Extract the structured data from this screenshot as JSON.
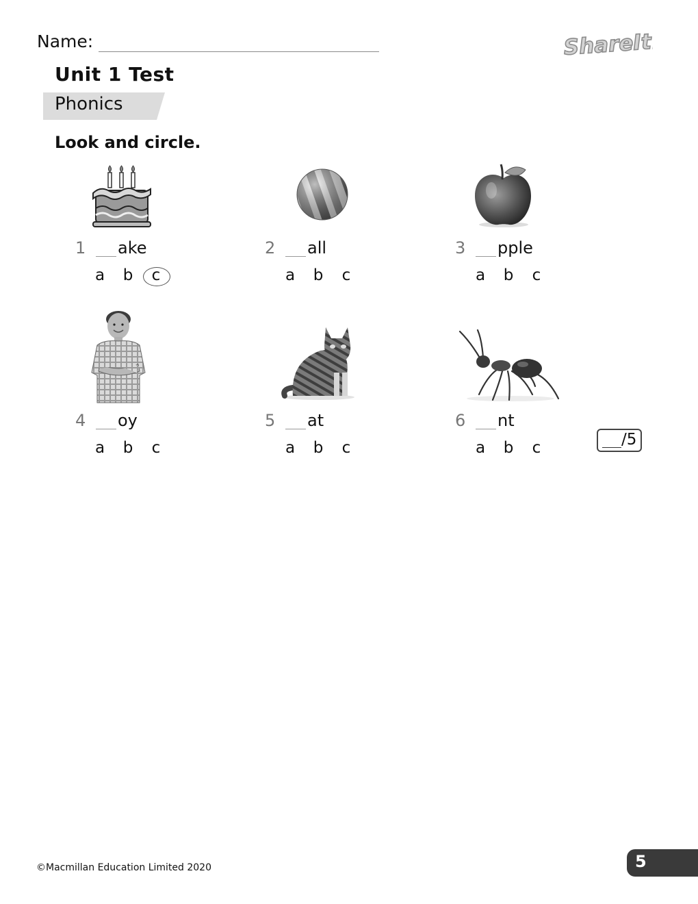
{
  "header": {
    "name_label": "Name:",
    "logo_text": "ShareIt!",
    "unit_title": "Unit 1 Test",
    "section": "Phonics",
    "instruction": "Look and circle."
  },
  "items": [
    {
      "number": "1",
      "word": "ake",
      "picture": "cake-icon",
      "options": [
        "a",
        "b",
        "c"
      ],
      "circled": "c"
    },
    {
      "number": "2",
      "word": "all",
      "picture": "ball-icon",
      "options": [
        "a",
        "b",
        "c"
      ],
      "circled": ""
    },
    {
      "number": "3",
      "word": "pple",
      "picture": "apple-icon",
      "options": [
        "a",
        "b",
        "c"
      ],
      "circled": ""
    },
    {
      "number": "4",
      "word": "oy",
      "picture": "boy-icon",
      "options": [
        "a",
        "b",
        "c"
      ],
      "circled": ""
    },
    {
      "number": "5",
      "word": "at",
      "picture": "cat-icon",
      "options": [
        "a",
        "b",
        "c"
      ],
      "circled": ""
    },
    {
      "number": "6",
      "word": "nt",
      "picture": "ant-icon",
      "options": [
        "a",
        "b",
        "c"
      ],
      "circled": ""
    }
  ],
  "score": {
    "total": "/5"
  },
  "footer": {
    "copyright": "©Macmillan Education Limited 2020",
    "page_number": "5"
  },
  "colors": {
    "band": "#dcdcdc",
    "page_tab": "#3a3a3a"
  }
}
